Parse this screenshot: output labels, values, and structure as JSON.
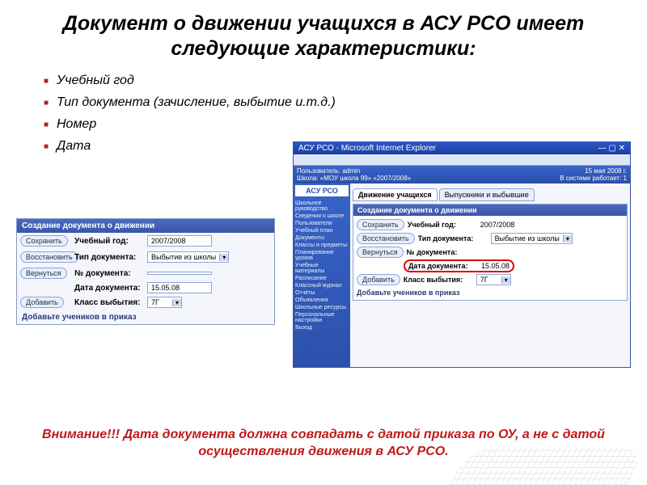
{
  "title": "Документ о движении учащихся в АСУ РСО имеет следующие характеристики:",
  "bullets": [
    "Учебный год",
    "Тип документа (зачисление, выбытие и.т.д.)",
    "Номер",
    "Дата"
  ],
  "panel_left": {
    "header": "Создание документа о движении",
    "buttons": {
      "save": "Сохранить",
      "restore": "Восстановить",
      "back": "Вернуться",
      "add": "Добавить"
    },
    "rows": {
      "year_label": "Учебный год:",
      "year_value": "2007/2008",
      "type_label": "Тип документа:",
      "type_value": "Выбытие из школы",
      "num_label": "№ документа:",
      "num_value": "",
      "date_label": "Дата документа:",
      "date_value": "15.05.08",
      "class_label": "Класс выбытия:",
      "class_value": "7Г"
    },
    "footer": "Добавьте учеников в приказ"
  },
  "panel_right": {
    "window_title": "АСУ РСО - Microsoft Internet Explorer",
    "header_date": "15 мая 2008 г.",
    "user_line_left": "Пользователь: admin",
    "user_line_school": "Школа: «МОУ школа 99»   «2007/2008»",
    "user_line_status": "В системе работает: 1",
    "logo": "АСУ РСО",
    "sidebar": [
      "Школьное руководство",
      "Сведения о школе",
      "Пользователи",
      "Учебный план",
      "Документы",
      "Классы и предметы",
      "Планирование уроков",
      "Учебные материалы",
      "Расписание",
      "Классный журнал",
      "Отчёты",
      "Объявления",
      "Школьные ресурсы",
      "Персональные настройки",
      "Выход"
    ],
    "tabs": {
      "active": "Движение учащихся",
      "inactive": "Выпускники и выбывшие"
    },
    "form_header": "Создание документа о движении",
    "buttons": {
      "save": "Сохранить",
      "restore": "Восстановить",
      "back": "Вернуться",
      "add": "Добавить"
    },
    "rows": {
      "year_label": "Учебный год:",
      "year_value": "2007/2008",
      "type_label": "Тип документа:",
      "type_value": "Выбытие из школы",
      "num_label": "№ документа:",
      "num_value": "",
      "date_label": "Дата документа:",
      "date_value": "15.05.08",
      "class_label": "Класс выбытия:",
      "class_value": "7Г"
    },
    "footer": "Добавьте учеников в приказ"
  },
  "footnote": "Внимание!!! Дата документа должна совпадать с датой приказа по ОУ, а не с датой осуществления движения в АСУ РСО."
}
